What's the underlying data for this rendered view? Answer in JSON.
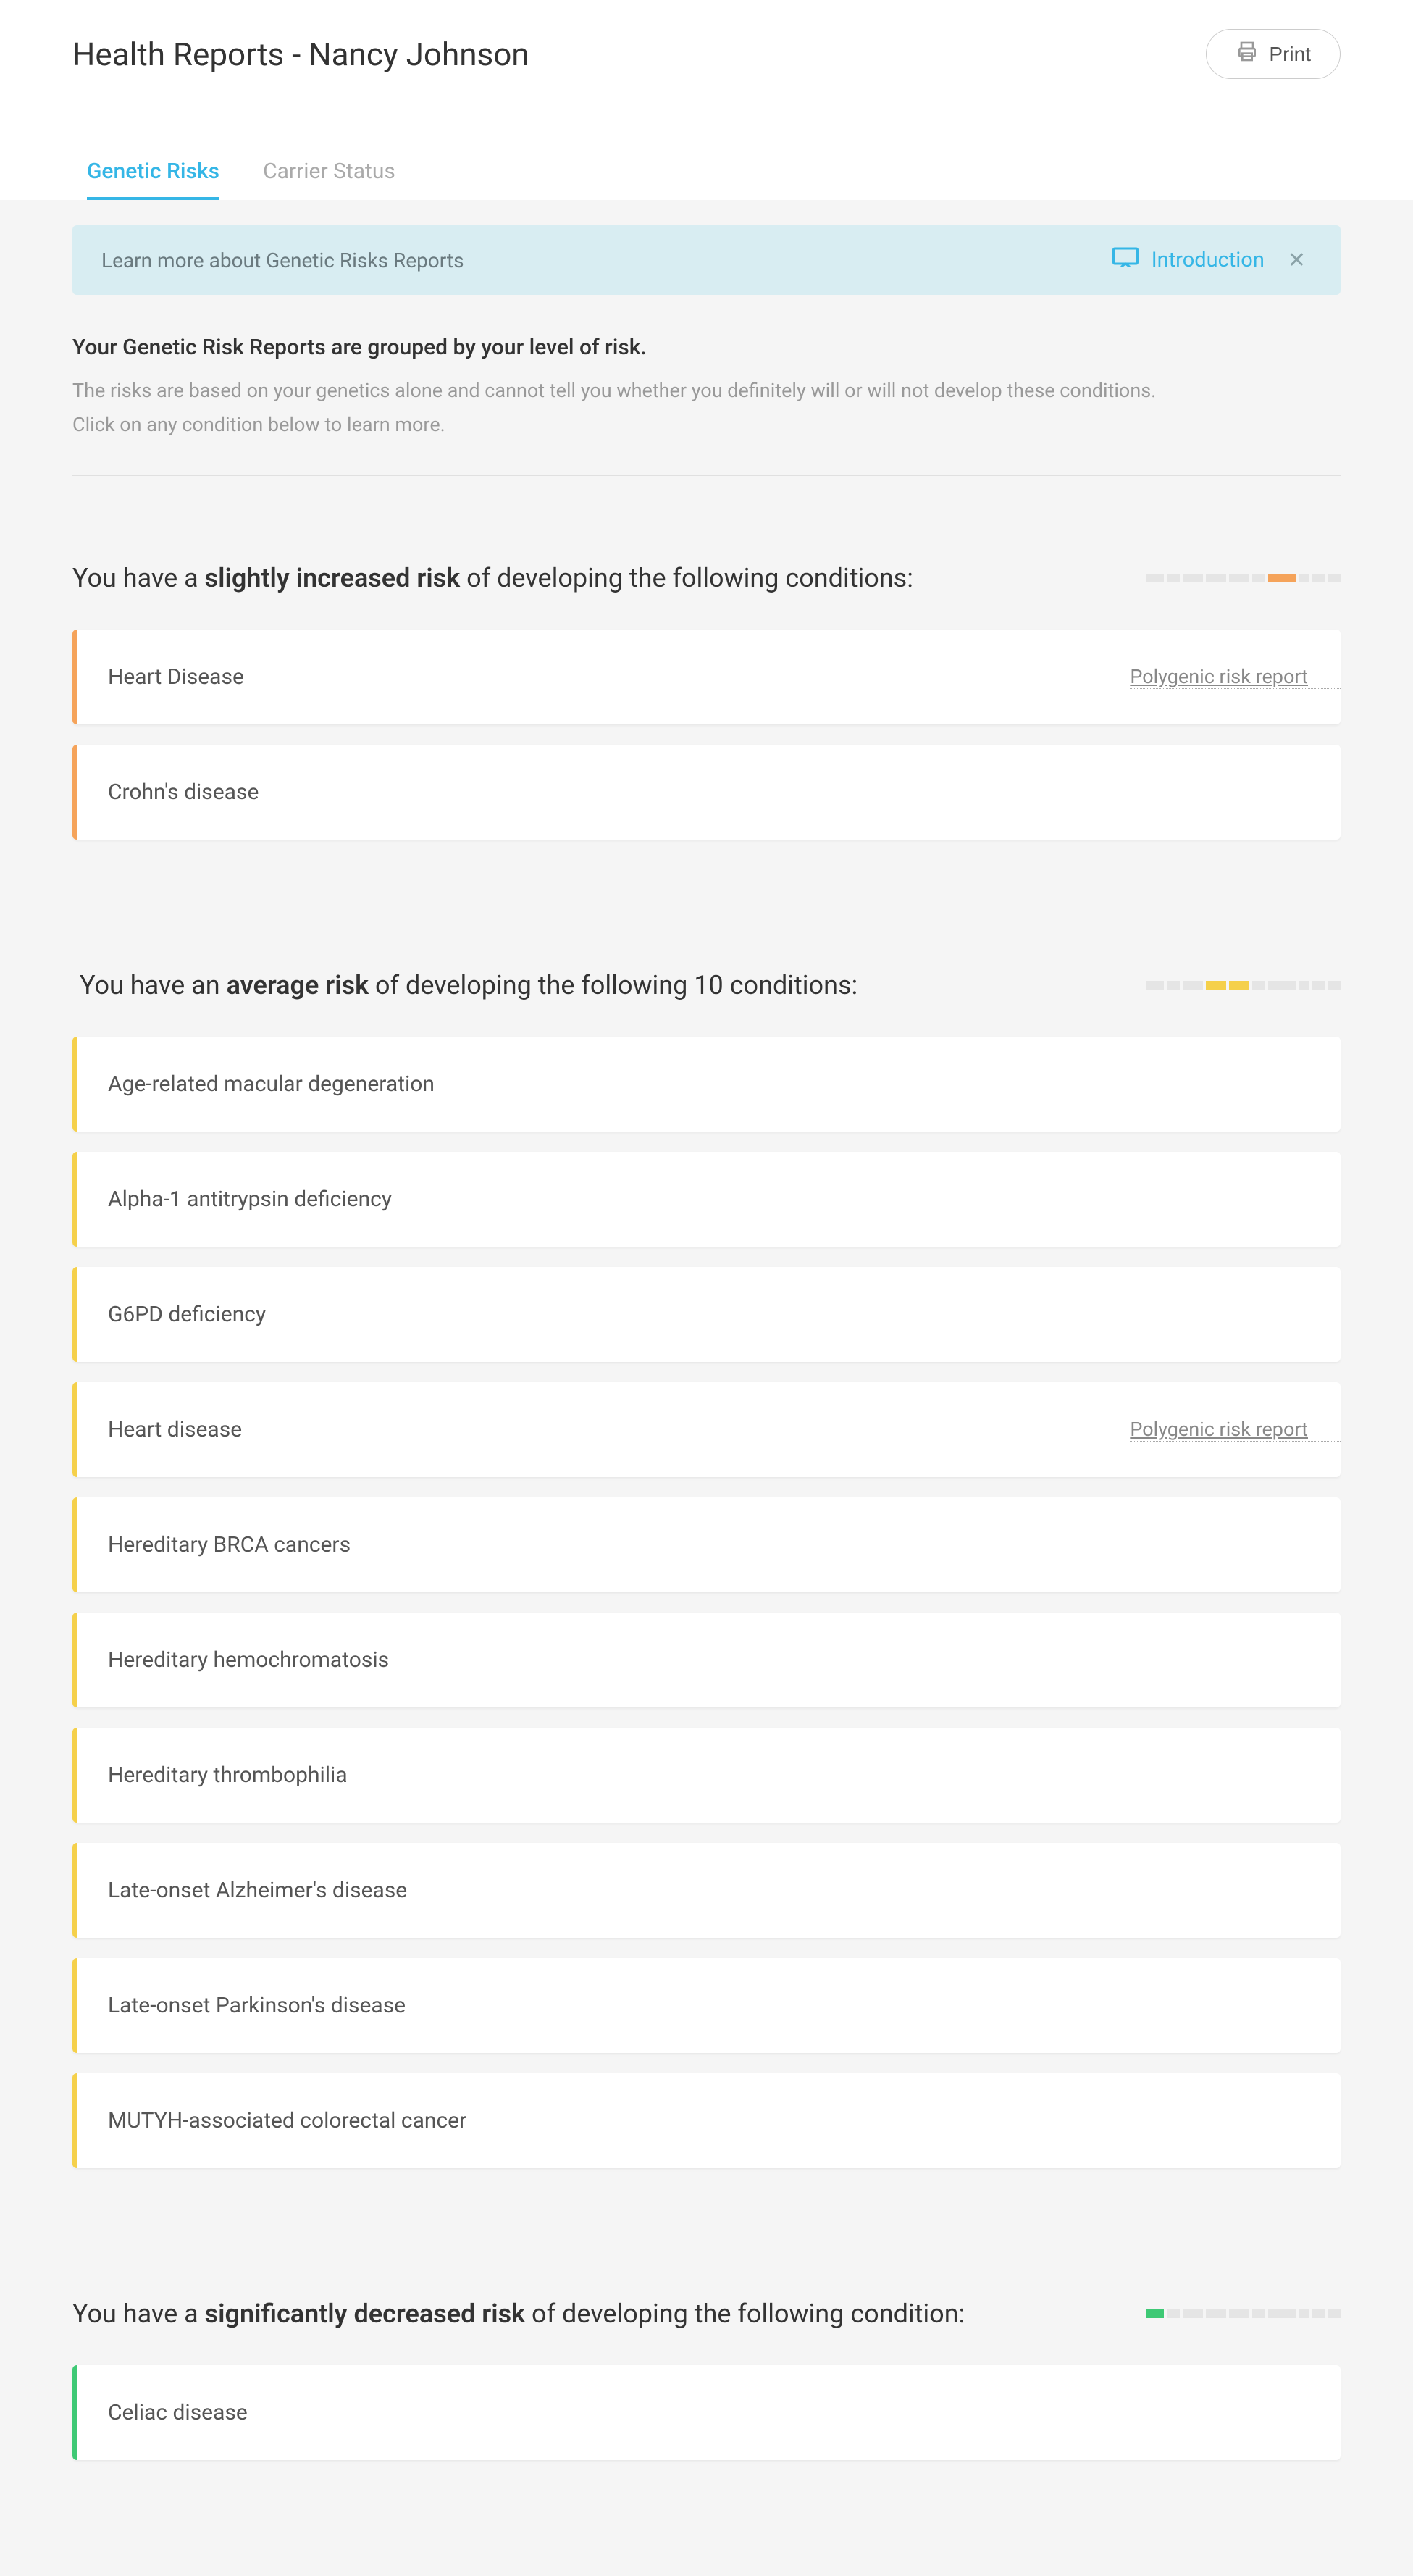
{
  "header": {
    "title": "Health Reports - Nancy Johnson",
    "print_label": "Print"
  },
  "tabs": {
    "genetic_risks": "Genetic Risks",
    "carrier_status": "Carrier Status"
  },
  "banner": {
    "text": "Learn more about Genetic Risks Reports",
    "intro_label": "Introduction"
  },
  "intro": {
    "title": "Your Genetic Risk Reports are grouped by your level of risk.",
    "line1": "The risks are based on your genetics alone and cannot tell you whether you definitely will or will not develop these conditions.",
    "line2": "Click on any condition below to learn more."
  },
  "polygenic_label": "Polygenic risk report",
  "sections": {
    "slightly_increased": {
      "prefix": "You have a ",
      "bold": "slightly increased risk",
      "suffix": " of developing the following conditions:",
      "scale_highlight_index": 6,
      "scale_color": "#f5a35a",
      "conditions": [
        {
          "name": "Heart Disease",
          "polygenic": true
        },
        {
          "name": "Crohn's disease",
          "polygenic": false
        }
      ]
    },
    "average": {
      "prefix": "You have an ",
      "bold": "average risk",
      "suffix": " of developing the following 10 conditions:",
      "scale_highlight_indices": [
        3,
        4
      ],
      "scale_color": "#f5d04a",
      "conditions": [
        {
          "name": "Age-related macular degeneration",
          "polygenic": false
        },
        {
          "name": "Alpha-1 antitrypsin deficiency",
          "polygenic": false
        },
        {
          "name": "G6PD deficiency",
          "polygenic": false
        },
        {
          "name": "Heart disease",
          "polygenic": true
        },
        {
          "name": "Hereditary BRCA cancers",
          "polygenic": false
        },
        {
          "name": "Hereditary hemochromatosis",
          "polygenic": false
        },
        {
          "name": "Hereditary thrombophilia",
          "polygenic": false
        },
        {
          "name": "Late-onset Alzheimer's disease",
          "polygenic": false
        },
        {
          "name": "Late-onset Parkinson's disease",
          "polygenic": false
        },
        {
          "name": "MUTYH-associated colorectal cancer",
          "polygenic": false
        }
      ]
    },
    "significantly_decreased": {
      "prefix": "You have a ",
      "bold": "significantly decreased risk",
      "suffix": " of developing the following condition:",
      "scale_highlight_index": 0,
      "scale_color": "#3ec975",
      "conditions": [
        {
          "name": "Celiac disease",
          "polygenic": false
        }
      ]
    }
  },
  "scale_widths": [
    24,
    18,
    28,
    28,
    28,
    18,
    38,
    14,
    18,
    18
  ]
}
